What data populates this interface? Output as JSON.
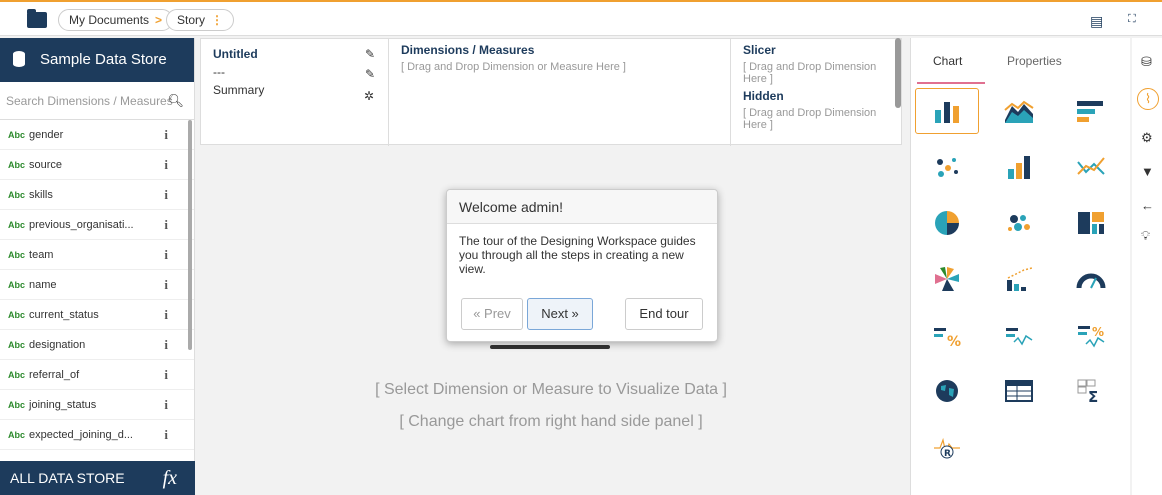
{
  "topbar": {
    "breadcrumb": [
      "My Documents",
      "Story"
    ]
  },
  "sidebar": {
    "title": "Sample Data Store",
    "search_placeholder": "Search Dimensions / Measures",
    "type_tag": "Abc",
    "fields": [
      "gender",
      "source",
      "skills",
      "previous_organisati...",
      "team",
      "name",
      "current_status",
      "designation",
      "referral_of",
      "joining_status",
      "expected_joining_d..."
    ],
    "footer": "ALL DATA STORE",
    "footer_icon": "fx"
  },
  "props": {
    "name_col": {
      "title": "Untitled",
      "dash": "---",
      "summary": "Summary"
    },
    "dimensions": {
      "title": "Dimensions / Measures",
      "hint": "[ Drag and Drop Dimension or Measure Here ]"
    },
    "slicer": {
      "title": "Slicer",
      "hint": "[ Drag and Drop Dimension Here ]"
    },
    "hidden": {
      "title": "Hidden",
      "hint": "[ Drag and Drop Dimension Here ]"
    }
  },
  "canvas": {
    "hint1": "[ Select Dimension or Measure to Visualize Data ]",
    "hint2": "[ Change chart from right hand side panel ]"
  },
  "tour": {
    "title": "Welcome admin!",
    "body": "The tour of the Designing Workspace guides you through all the steps in creating a new view.",
    "prev": "« Prev",
    "next": "Next »",
    "end": "End tour"
  },
  "right_panel": {
    "tabs": [
      "Chart",
      "Properties"
    ],
    "chart_icons": [
      "bar-line-icon",
      "area-icon",
      "horizontal-bar-icon",
      "scatter-icon",
      "column-icon",
      "line-icon",
      "pie-icon",
      "bubble-icon",
      "treemap-icon",
      "sunburst-icon",
      "area-scatter-icon",
      "gauge-icon",
      "kpi-percent-icon",
      "kpi-trend-icon",
      "kpi-trend-percent-icon",
      "map-icon",
      "table-icon",
      "pivot-sum-icon",
      "r-chart-icon"
    ]
  },
  "colors": {
    "navy": "#1d3b5c",
    "orange": "#f0a030",
    "teal": "#2aa3b8",
    "green": "#2d8a2d"
  }
}
